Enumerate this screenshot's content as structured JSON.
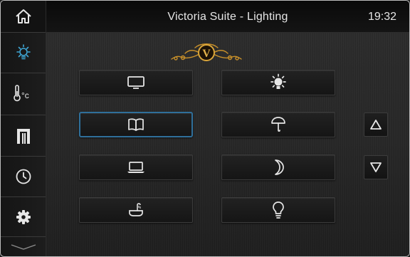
{
  "header": {
    "title": "Victoria Suite - Lighting",
    "time": "19:32"
  },
  "logo": {
    "letter": "V"
  },
  "sidebar": {
    "items": [
      {
        "name": "home-icon",
        "active": false
      },
      {
        "name": "lightbulb-icon",
        "active": true
      },
      {
        "name": "thermometer-icon",
        "label": "°c",
        "active": false
      },
      {
        "name": "blinds-icon",
        "active": false
      },
      {
        "name": "clock-icon",
        "active": false
      },
      {
        "name": "gear-icon",
        "active": false
      },
      {
        "name": "chevron-down-icon",
        "active": false
      }
    ]
  },
  "scenes": {
    "left": [
      "tv-icon",
      "book-icon",
      "laptop-icon",
      "bathtub-icon"
    ],
    "right": [
      "bright-light-icon",
      "floor-lamp-icon",
      "moon-icon",
      "bulb-icon"
    ],
    "selected": "book-icon"
  },
  "colors": {
    "accent": "#3fa7d6",
    "selected_border": "#2f6f9a",
    "logo_gold": "#c8902a"
  }
}
